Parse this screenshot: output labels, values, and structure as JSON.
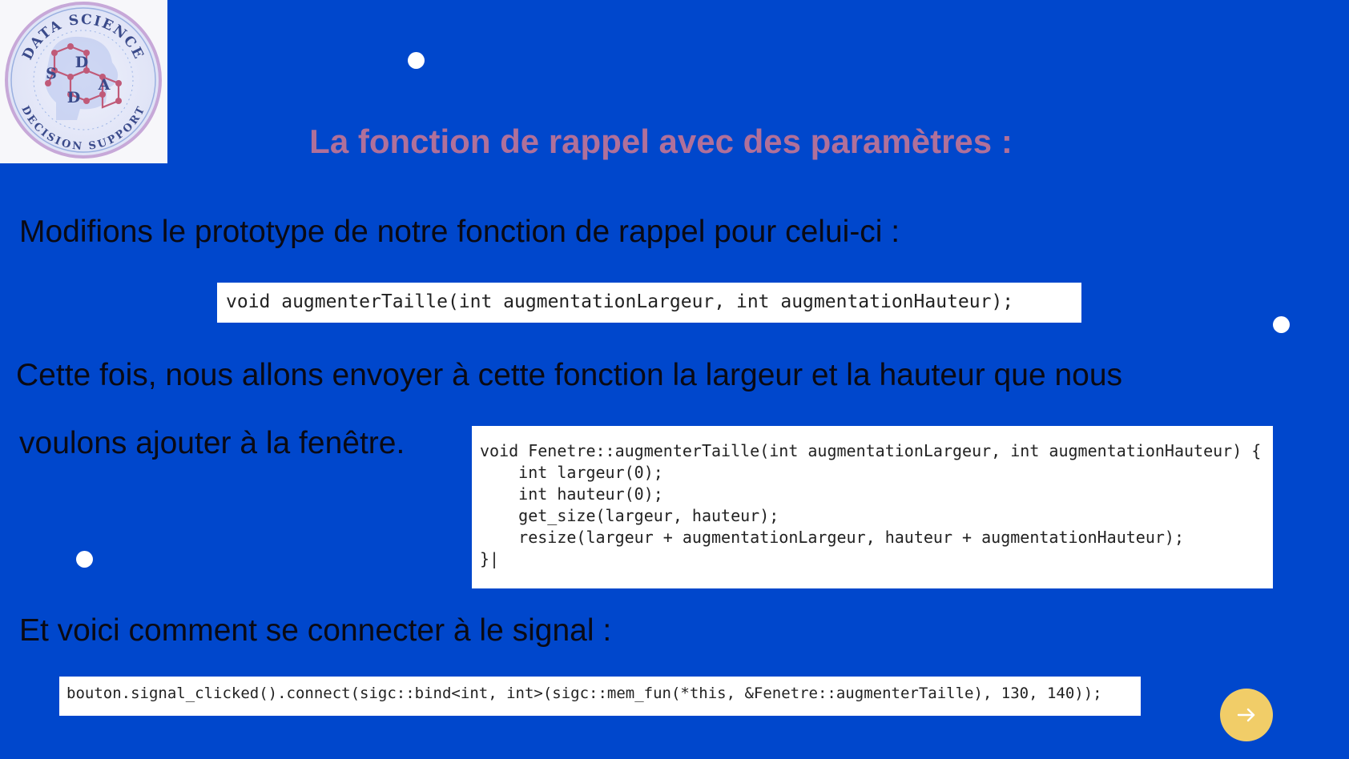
{
  "logo": {
    "top_text": "DATA SCIENCE",
    "bottom_text": "DECISION SUPPORT",
    "letters": [
      "S",
      "D",
      "A",
      "D"
    ]
  },
  "slide": {
    "title": "La fonction de rappel avec des paramètres :",
    "intro": "Modifions le prototype de notre fonction de rappel pour celui-ci :",
    "prototype_code": "void augmenterTaille(int augmentationLargeur, int augmentationHauteur);",
    "explanation_line1": "Cette fois, nous allons envoyer à cette fonction la largeur et la hauteur que nous",
    "explanation_line2": "voulons ajouter à la fenêtre.",
    "implementation_code": "void Fenetre::augmenterTaille(int augmentationLargeur, int augmentationHauteur) {\n    int largeur(0);\n    int hauteur(0);\n    get_size(largeur, hauteur);\n    resize(largeur + augmentationLargeur, hauteur + augmentationHauteur);\n}|",
    "connect_text": "Et voici comment se connecter à le signal :",
    "connect_code": "bouton.signal_clicked().connect(sigc::bind<int, int>(sigc::mem_fun(*this, &Fenetre::augmenterTaille), 130, 140));"
  },
  "navigation": {
    "next_icon": "arrow-right-icon"
  },
  "colors": {
    "background": "#0047cc",
    "title": "#b0709a",
    "text": "#0a0a14",
    "next_button": "#f1cd68"
  }
}
